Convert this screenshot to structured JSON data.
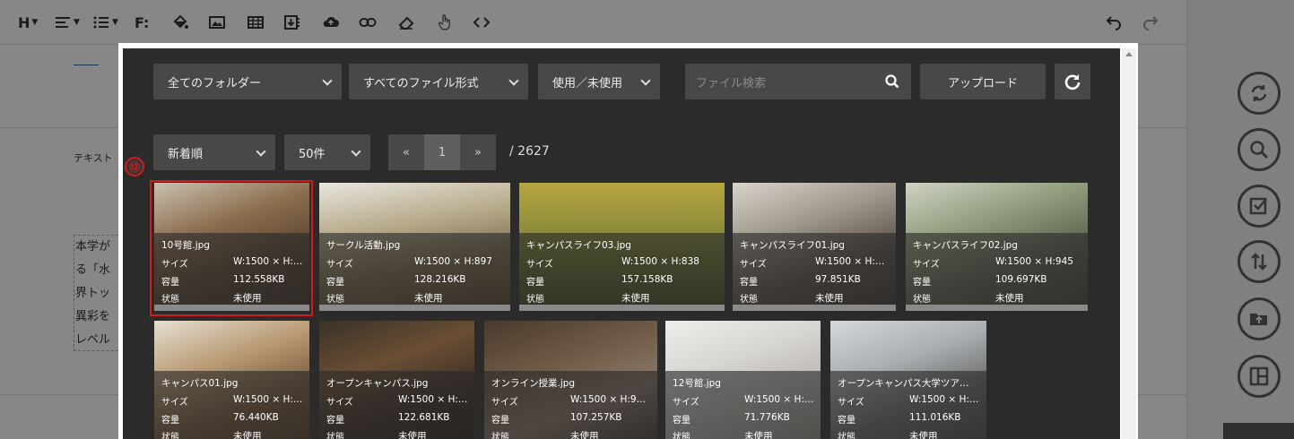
{
  "editor": {
    "label": "テキスト",
    "text_lines": [
      "本学が",
      "る「水",
      "界トッ",
      "異彩を",
      "レベル"
    ]
  },
  "toolbar_icons": [
    "heading-icon",
    "align-icon",
    "list-icon",
    "font-icon",
    "paint-bucket-icon",
    "image-icon",
    "table-icon",
    "download-icon",
    "cloud-upload-icon",
    "link-icon",
    "eraser-icon",
    "hand-pointer-icon",
    "code-icon",
    "undo-icon",
    "redo-icon"
  ],
  "toolbar": {
    "heading_label": "H",
    "font_label": "F:"
  },
  "filters": {
    "folder": "全てのフォルダー",
    "file_type": "すべてのファイル形式",
    "usage": "使用／未使用",
    "search_placeholder": "ファイル検索",
    "upload_label": "アップロード"
  },
  "sorting": {
    "order": "新着順",
    "per_page": "50件"
  },
  "pagination": {
    "prev": "«",
    "current": "1",
    "next": "»",
    "total": "/ 2627"
  },
  "labels": {
    "size": "サイズ",
    "capacity": "容量",
    "status": "状態"
  },
  "callout": "⑫",
  "colors": {
    "highlight": "#d21b1b",
    "panel": "#2b2b2b",
    "control": "#484848"
  },
  "images": [
    {
      "name": "10号館.jpg",
      "size": "W:1500 × H:…",
      "capacity": "112.558KB",
      "status": "未使用"
    },
    {
      "name": "サークル活動.jpg",
      "size": "W:1500 × H:897",
      "capacity": "128.216KB",
      "status": "未使用"
    },
    {
      "name": "キャンパスライフ03.jpg",
      "size": "W:1500 × H:838",
      "capacity": "157.158KB",
      "status": "未使用"
    },
    {
      "name": "キャンパスライフ01.jpg",
      "size": "W:1500 × H:…",
      "capacity": "97.851KB",
      "status": "未使用"
    },
    {
      "name": "キャンパスライフ02.jpg",
      "size": "W:1500 × H:945",
      "capacity": "109.697KB",
      "status": "未使用"
    },
    {
      "name": "キャンパス01.jpg",
      "size": "W:1500 × H:…",
      "capacity": "76.440KB",
      "status": "未使用"
    },
    {
      "name": "オープンキャンパス.jpg",
      "size": "W:1500 × H:…",
      "capacity": "122.681KB",
      "status": "未使用"
    },
    {
      "name": "オンライン授業.jpg",
      "size": "W:1500 × H:9…",
      "capacity": "107.257KB",
      "status": "未使用"
    },
    {
      "name": "12号館.jpg",
      "size": "W:1500 × H:…",
      "capacity": "71.776KB",
      "status": "未使用"
    },
    {
      "name": "オープンキャンパス大学ツア…",
      "size": "W:1500 × H:…",
      "capacity": "111.016KB",
      "status": "未使用"
    }
  ]
}
